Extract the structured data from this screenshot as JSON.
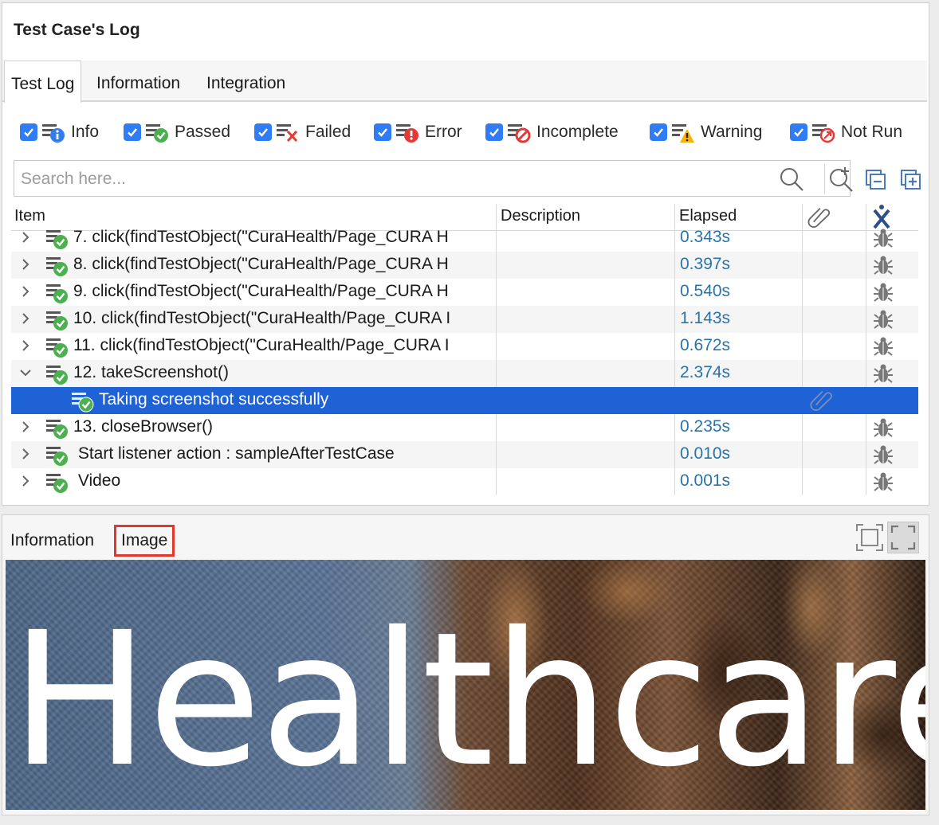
{
  "panel_title": "Test Case's Log",
  "tabs": [
    {
      "label": "Test Log",
      "active": true
    },
    {
      "label": "Information",
      "active": false
    },
    {
      "label": "Integration",
      "active": false
    }
  ],
  "filters": [
    {
      "label": "Info",
      "checked": true,
      "icon": "info-icon"
    },
    {
      "label": "Passed",
      "checked": true,
      "icon": "passed-icon"
    },
    {
      "label": "Failed",
      "checked": true,
      "icon": "failed-icon"
    },
    {
      "label": "Error",
      "checked": true,
      "icon": "error-icon"
    },
    {
      "label": "Incomplete",
      "checked": true,
      "icon": "incomplete-icon"
    },
    {
      "label": "Warning",
      "checked": true,
      "icon": "warning-icon"
    },
    {
      "label": "Not Run",
      "checked": true,
      "icon": "not-run-icon"
    }
  ],
  "search": {
    "placeholder": "Search here..."
  },
  "table": {
    "columns": {
      "item": "Item",
      "description": "Description",
      "elapsed": "Elapsed"
    },
    "rows": [
      {
        "text": "7. click(findTestObject(\"CuraHealth/Page_CURA H",
        "elapsed": "0.343s",
        "expanded": false
      },
      {
        "text": "8. click(findTestObject(\"CuraHealth/Page_CURA H",
        "elapsed": "0.397s",
        "expanded": false
      },
      {
        "text": "9. click(findTestObject(\"CuraHealth/Page_CURA H",
        "elapsed": "0.540s",
        "expanded": false
      },
      {
        "text": "10. click(findTestObject(\"CuraHealth/Page_CURA I",
        "elapsed": "1.143s",
        "expanded": false
      },
      {
        "text": "11. click(findTestObject(\"CuraHealth/Page_CURA I",
        "elapsed": "0.672s",
        "expanded": false
      },
      {
        "text": "12. takeScreenshot()",
        "elapsed": "2.374s",
        "expanded": true
      },
      {
        "text": "Taking screenshot successfully",
        "elapsed": "",
        "child": true,
        "selected": true,
        "attachment": true
      },
      {
        "text": "13. closeBrowser()",
        "elapsed": "0.235s",
        "expanded": false
      },
      {
        "text": " Start listener action : sampleAfterTestCase",
        "elapsed": "0.010s",
        "expanded": false
      },
      {
        "text": " Video",
        "elapsed": "0.001s",
        "expanded": false
      }
    ]
  },
  "bottom_tabs": [
    {
      "label": "Information",
      "active": false
    },
    {
      "label": "Image",
      "active": true,
      "highlighted": true
    }
  ],
  "image": {
    "caption": "Healthcare"
  },
  "colors": {
    "accent": "#2f7cf6",
    "selection": "#1f62d5",
    "elapsed_text": "#2a73a8",
    "passed": "#4caf50",
    "highlight_border": "#e2382c"
  }
}
